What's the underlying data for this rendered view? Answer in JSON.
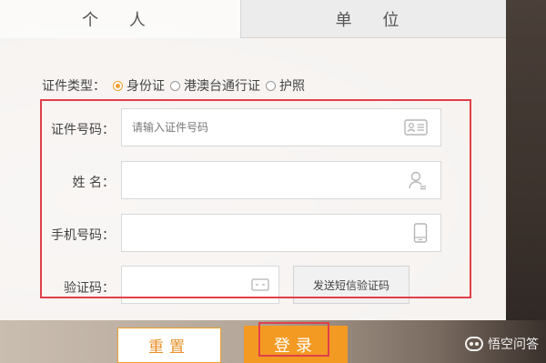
{
  "tabs": {
    "personal": "个 人",
    "company": "单 位"
  },
  "id_type": {
    "label": "证件类型：",
    "options": [
      "身份证",
      "港澳台通行证",
      "护照"
    ],
    "selected": "身份证"
  },
  "fields": {
    "id_number": {
      "label": "证件号码：",
      "placeholder": "请输入证件号码",
      "icon": "id-card-icon"
    },
    "name": {
      "label": "姓 名：",
      "placeholder": "",
      "icon": "user-icon"
    },
    "phone": {
      "label": "手机号码：",
      "placeholder": "",
      "icon": "phone-icon"
    },
    "code": {
      "label": "验证码：",
      "placeholder": "",
      "icon": "captcha-icon"
    }
  },
  "buttons": {
    "send_sms": "发送短信验证码",
    "reset": "重置",
    "login": "登录"
  },
  "watermark": "悟空问答",
  "colors": {
    "accent": "#f39a22",
    "highlight": "#e0404a"
  }
}
